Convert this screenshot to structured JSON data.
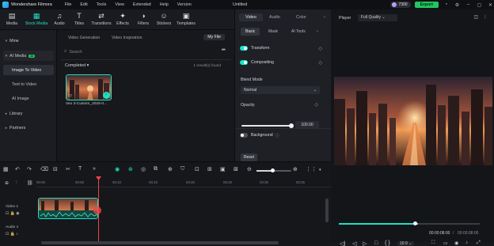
{
  "app": {
    "title": "Wondershare Filmora",
    "doc_title": "Untitled",
    "credits": "7300",
    "export_label": "Export"
  },
  "menu": [
    "File",
    "Edit",
    "Tools",
    "View",
    "Extended",
    "Help",
    "Version"
  ],
  "toolbar": [
    {
      "label": "Media",
      "icon": "media-icon"
    },
    {
      "label": "Stock Media",
      "icon": "stock-media-icon",
      "active": true
    },
    {
      "label": "Audio",
      "icon": "audio-icon"
    },
    {
      "label": "Titles",
      "icon": "titles-icon"
    },
    {
      "label": "Transitions",
      "icon": "transitions-icon"
    },
    {
      "label": "Effects",
      "icon": "effects-icon"
    },
    {
      "label": "Filters",
      "icon": "filters-icon"
    },
    {
      "label": "Stickers",
      "icon": "stickers-icon"
    },
    {
      "label": "Templates",
      "icon": "templates-icon"
    }
  ],
  "sidebar": {
    "mine": "Mine",
    "ai_media": "AI Media",
    "ai_badge": "AI",
    "items": [
      "Image To Video",
      "Text to Video",
      "AI Image"
    ],
    "library": "Library",
    "partners": "Partners"
  },
  "media": {
    "tabs": [
      "Video Generation",
      "Video Inspiration"
    ],
    "my_file": "My File",
    "search_placeholder": "Search",
    "completed": "Completed",
    "found": "1 result(s) found",
    "thumb_name": "Veo 3-Custom_2025-0..."
  },
  "inspector": {
    "tabs": [
      "Video",
      "Audio",
      "Color"
    ],
    "subtabs": [
      "Basic",
      "Mask",
      "AI Tools"
    ],
    "transform": "Transform",
    "compositing": "Compositing",
    "blend_mode_label": "Blend Mode",
    "blend_mode_value": "Normal",
    "opacity_label": "Opacity",
    "opacity_value": "100.00",
    "opacity_level": 1.0,
    "background": "Background",
    "reset": "Reset"
  },
  "player": {
    "label": "Player",
    "quality": "Full Quality",
    "current_time": "00:00:08:00",
    "total_time": "00:00:08:00",
    "ratio": "16:9",
    "progress": 0.56
  },
  "timeline": {
    "ticks": [
      "00:00",
      "00:05",
      "00:10",
      "00:15",
      "00:20",
      "00:25",
      "00:30",
      "00:35"
    ],
    "video_track": "Video 1",
    "audio_track": "Audio 1"
  },
  "colors": {
    "accent": "#1ee0c4",
    "export": "#22c55e",
    "playhead": "#ef4444"
  }
}
